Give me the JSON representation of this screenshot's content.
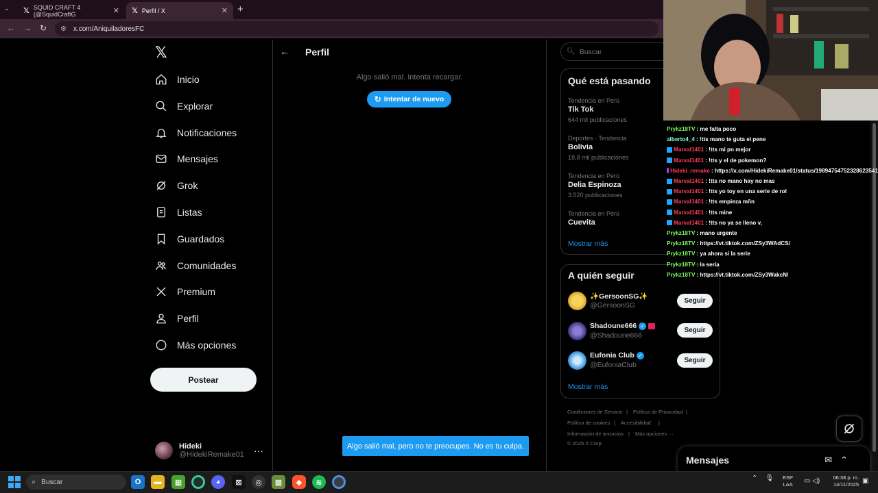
{
  "browser": {
    "tabs": [
      {
        "label": "SQUID CRAFT 4 (@SquidCraftG"
      },
      {
        "label": "Perfil / X"
      }
    ],
    "url": "x.com/AniquiladoresFC"
  },
  "sidebar": {
    "items": [
      {
        "label": "Inicio",
        "icon": "home-icon"
      },
      {
        "label": "Explorar",
        "icon": "search-icon"
      },
      {
        "label": "Notificaciones",
        "icon": "bell-icon"
      },
      {
        "label": "Mensajes",
        "icon": "mail-icon"
      },
      {
        "label": "Grok",
        "icon": "grok-icon"
      },
      {
        "label": "Listas",
        "icon": "list-icon"
      },
      {
        "label": "Guardados",
        "icon": "bookmark-icon"
      },
      {
        "label": "Comunidades",
        "icon": "communities-icon"
      },
      {
        "label": "Premium",
        "icon": "x-logo-icon"
      },
      {
        "label": "Perfil",
        "icon": "person-icon"
      },
      {
        "label": "Más opciones",
        "icon": "more-circle-icon"
      }
    ],
    "post_label": "Postear",
    "profile": {
      "name": "Hideki",
      "handle": "@HidekiRemake01"
    }
  },
  "main": {
    "title": "Perfil",
    "error": "Algo salió mal. Intenta recargar.",
    "retry_label": "Intentar de nuevo",
    "toast": "Algo salió mal, pero no te preocupes. No es tu culpa."
  },
  "right": {
    "search_placeholder": "Buscar",
    "trends_title": "Qué está pasando",
    "trends": [
      {
        "meta": "Tendencia en Perú",
        "name": "Tik Tok",
        "count": "644 mil publicaciones"
      },
      {
        "meta": "Deportes · Tendencia",
        "name": "Bolivia",
        "count": "18,8 mil publicaciones"
      },
      {
        "meta": "Tendencia en Perú",
        "name": "Delia Espinoza",
        "count": "3.520 publicaciones"
      },
      {
        "meta": "Tendencia en Perú",
        "name": "Cuevita",
        "count": ""
      }
    ],
    "show_more": "Mostrar más",
    "follow_title": "A quién seguir",
    "follow": [
      {
        "name": "✨GersoonSG✨",
        "handle": "@GersoonSG",
        "button": "Seguir",
        "verified": false
      },
      {
        "name": "Shadoune666",
        "handle": "@Shadoune666",
        "button": "Seguir",
        "verified": true
      },
      {
        "name": "Eufonia Club",
        "handle": "@EufoniaClub",
        "button": "Seguir",
        "verified": true
      }
    ],
    "footer": {
      "row1": [
        "Condiciones de Servicio",
        "Política de Privacidad"
      ],
      "row2": [
        "Política de cookies",
        "Accesibilidad"
      ],
      "row3": [
        "Información de anuncios",
        "Más opciones ···"
      ],
      "copyright": "© 2025 X Corp."
    }
  },
  "messages_drawer": {
    "title": "Mensajes"
  },
  "chat": [
    {
      "user": "Prykz18TV",
      "color": "#7dff5a",
      "badge": "",
      "text": ": me falta poco"
    },
    {
      "user": "alberto4_4",
      "color": "#7dffdf",
      "badge": "",
      "text": ": !tts mano te guta el pene"
    },
    {
      "user": "Marval1401",
      "color": "#ff3b5c",
      "badge": "blue",
      "text": ": !tts mi pn mejor"
    },
    {
      "user": "Marval1401",
      "color": "#ff3b5c",
      "badge": "blue",
      "text": ": !tts y el de pokemon?"
    },
    {
      "user": "Hideki_remake",
      "color": "#ff3b5c",
      "badge": "purple",
      "text": ": https://x.com/HidekiRemake01/status/19894754752328623541"
    },
    {
      "user": "Marval1401",
      "color": "#ff3b5c",
      "badge": "blue",
      "text": ": !tts no mano hay no mas"
    },
    {
      "user": "Marval1401",
      "color": "#ff3b5c",
      "badge": "blue",
      "text": ": !tts yo toy en una serie de rol"
    },
    {
      "user": "Marval1401",
      "color": "#ff3b5c",
      "badge": "blue",
      "text": ": !tts empieza mñn"
    },
    {
      "user": "Marval1401",
      "color": "#ff3b5c",
      "badge": "blue",
      "text": ": !tts mine"
    },
    {
      "user": "Marval1401",
      "color": "#ff3b5c",
      "badge": "blue",
      "text": ": !tts no ya se lleno v,"
    },
    {
      "user": "Prykz18TV",
      "color": "#7dff5a",
      "badge": "",
      "text": ": mano urgente"
    },
    {
      "user": "Prykz18TV",
      "color": "#7dff5a",
      "badge": "",
      "text": ": https://vt.tiktok.com/ZSy3WAdCS/"
    },
    {
      "user": "Prykz18TV",
      "color": "#7dff5a",
      "badge": "",
      "text": ": ya ahora sí la serie"
    },
    {
      "user": "Prykz18TV",
      "color": "#7dff5a",
      "badge": "",
      "text": ": la sería"
    },
    {
      "user": "Prykz18TV",
      "color": "#7dff5a",
      "badge": "",
      "text": ": https://vt.tiktok.com/ZSy3WakcN/"
    }
  ],
  "taskbar": {
    "search_placeholder": "Buscar",
    "lang_top": "ESP",
    "lang_bottom": "LAA",
    "time": "06:38 p. m.",
    "date": "14/11/2025"
  },
  "colors": {
    "accent": "#1d9bf0",
    "background": "#000000",
    "muted": "#71767b"
  }
}
